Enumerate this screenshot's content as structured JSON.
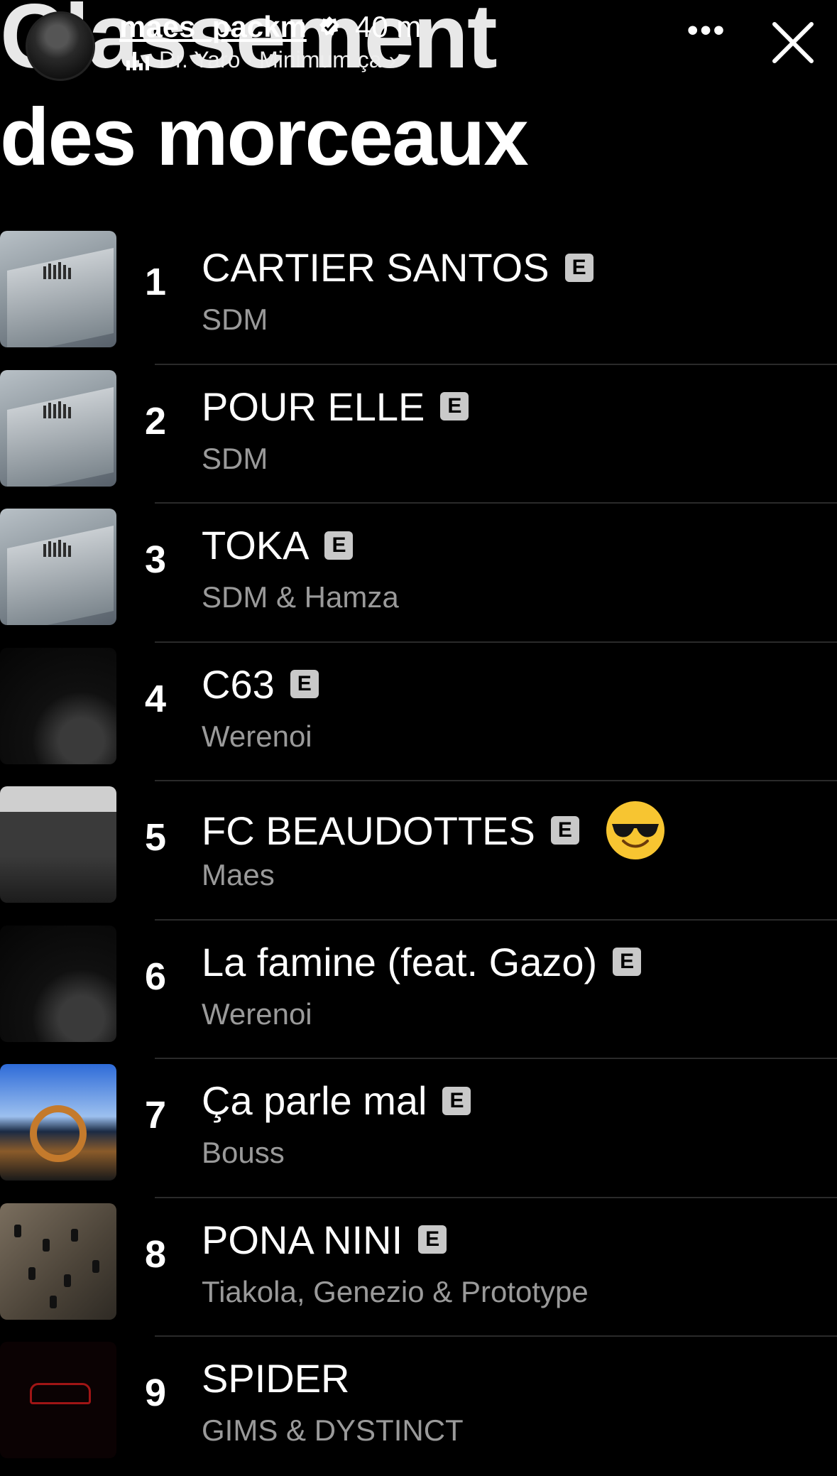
{
  "story": {
    "username": "maes_packm",
    "time": "40 m",
    "music_artist": "Dr. Yaro",
    "music_separator": "·",
    "music_title": "Minimum ça",
    "chevron": "›",
    "more_icon": "more-horizontal-icon",
    "close_icon": "close-icon"
  },
  "page": {
    "title_line1": "Classement",
    "title_line2": "des morceaux"
  },
  "explicit_label": "E",
  "tracks": [
    {
      "rank": "1",
      "title": "CARTIER SANTOS",
      "artist": "SDM",
      "explicit": true
    },
    {
      "rank": "2",
      "title": "POUR ELLE",
      "artist": "SDM",
      "explicit": true
    },
    {
      "rank": "3",
      "title": "TOKA",
      "artist": "SDM & Hamza",
      "explicit": true
    },
    {
      "rank": "4",
      "title": "C63",
      "artist": "Werenoi",
      "explicit": true
    },
    {
      "rank": "5",
      "title": "FC BEAUDOTTES",
      "artist": "Maes",
      "explicit": true,
      "emoji": "smiling-face-with-sunglasses"
    },
    {
      "rank": "6",
      "title": "La famine (feat. Gazo)",
      "artist": "Werenoi",
      "explicit": true
    },
    {
      "rank": "7",
      "title": "Ça parle mal",
      "artist": "Bouss",
      "explicit": true
    },
    {
      "rank": "8",
      "title": "PONA NINI",
      "artist": "Tiakola, Genezio & Prototype",
      "explicit": true
    },
    {
      "rank": "9",
      "title": "SPIDER",
      "artist": "GIMS & DYSTINCT",
      "explicit": false
    }
  ],
  "colors": {
    "background": "#000000",
    "primary_text": "#ffffff",
    "secondary_text": "#9a9a9a",
    "explicit_badge": "#c9c9c9",
    "divider": "#2a2a2a"
  }
}
